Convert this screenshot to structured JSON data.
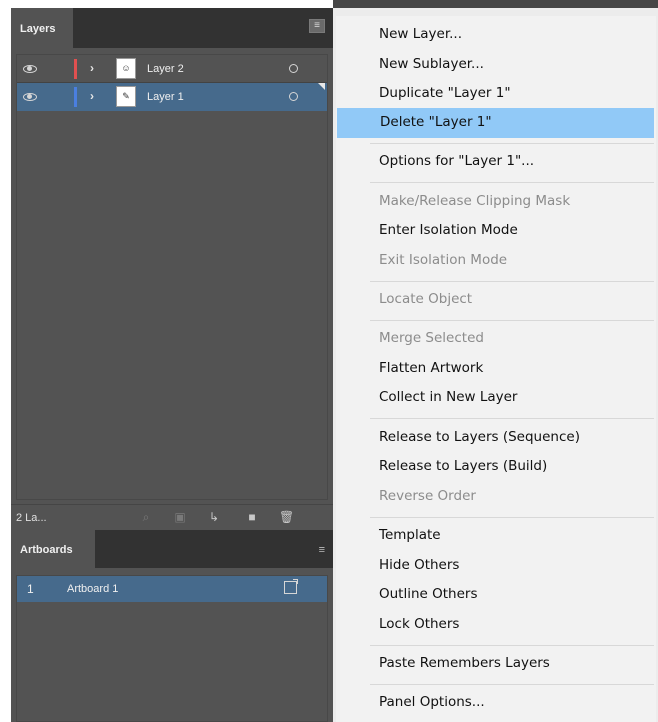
{
  "layers_panel": {
    "tab_label": "Layers",
    "menu_icon": "hamburger-menu-icon",
    "layers": [
      {
        "name": "Layer 2",
        "color": "#e05050",
        "selected": false
      },
      {
        "name": "Layer 1",
        "color": "#4a7fe0",
        "selected": true
      }
    ],
    "footer_count": "2 La...",
    "footer_icons": [
      "search-icon",
      "make-clipping-mask-icon",
      "create-new-sublayer-icon",
      "create-new-layer-icon",
      "trash-icon"
    ]
  },
  "artboards_panel": {
    "tab_label": "Artboards",
    "rows": [
      {
        "number": "1",
        "name": "Artboard 1"
      }
    ]
  },
  "context_menu": {
    "items": [
      {
        "label": "New Layer...",
        "disabled": false
      },
      {
        "label": "New Sublayer...",
        "disabled": false
      },
      {
        "label": "Duplicate \"Layer 1\"",
        "disabled": false
      },
      {
        "label": "Delete \"Layer 1\"",
        "disabled": false,
        "highlighted": true
      },
      {
        "label": "Options for \"Layer 1\"...",
        "disabled": false
      },
      {
        "label": "Make/Release Clipping Mask",
        "disabled": true
      },
      {
        "label": "Enter Isolation Mode",
        "disabled": false
      },
      {
        "label": "Exit Isolation Mode",
        "disabled": true
      },
      {
        "label": "Locate Object",
        "disabled": true
      },
      {
        "label": "Merge Selected",
        "disabled": true
      },
      {
        "label": "Flatten Artwork",
        "disabled": false
      },
      {
        "label": "Collect in New Layer",
        "disabled": false
      },
      {
        "label": "Release to Layers (Sequence)",
        "disabled": false
      },
      {
        "label": "Release to Layers (Build)",
        "disabled": false
      },
      {
        "label": "Reverse Order",
        "disabled": true
      },
      {
        "label": "Template",
        "disabled": false
      },
      {
        "label": "Hide Others",
        "disabled": false
      },
      {
        "label": "Outline Others",
        "disabled": false
      },
      {
        "label": "Lock Others",
        "disabled": false
      },
      {
        "label": "Paste Remembers Layers",
        "disabled": false
      },
      {
        "label": "Panel Options...",
        "disabled": false
      }
    ]
  },
  "colors": {
    "panel_bg": "#535353",
    "selection_bg": "#466a8c",
    "menu_highlight": "#91c9f7",
    "menu_bg": "#f2f2f2"
  }
}
